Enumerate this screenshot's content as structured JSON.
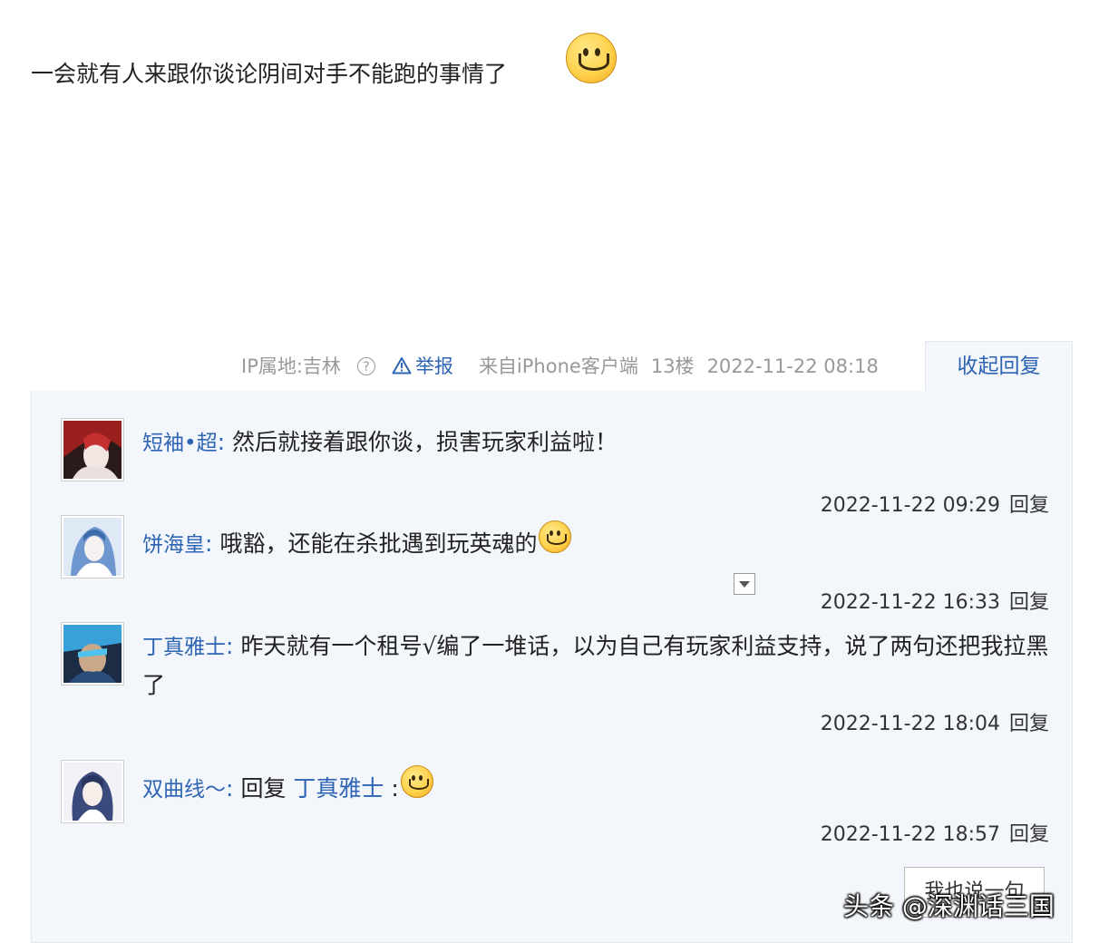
{
  "post": {
    "text": "一会就有人来跟你谈论阴间对手不能跑的事情了",
    "meta": {
      "ip": "IP属地:吉林",
      "help": "?",
      "report": "举报",
      "source": "来自iPhone客户端",
      "floor": "13楼",
      "time": "2022-11-22 08:18"
    },
    "collapse_label": "收起回复"
  },
  "replies": [
    {
      "name": "短袖•超",
      "colon": ":",
      "text": "然后就接着跟你谈，损害玩家利益啦！",
      "time": "2022-11-22 09:29",
      "reply_label": "回复"
    },
    {
      "name": "饼海皇",
      "colon": ":",
      "text": "哦豁，还能在杀批遇到玩英魂的",
      "time": "2022-11-22 16:33",
      "reply_label": "回复"
    },
    {
      "name": "丁真雅士",
      "colon": ":",
      "text": "昨天就有一个租号√编了一堆话，以为自己有玩家利益支持，说了两句还把我拉黑了",
      "time": "2022-11-22 18:04",
      "reply_label": "回复"
    },
    {
      "name": "双曲线～",
      "colon": ":",
      "prefix": "回复",
      "target": "丁真雅士",
      "suffix": ":",
      "time": "2022-11-22 18:57",
      "reply_label": "回复"
    }
  ],
  "say_button": "我也说一句",
  "watermark": "头条 @深渊话三国",
  "colors": {
    "link": "#2d64b3",
    "panel_bg": "#f3f6fb",
    "meta_gray": "#999999"
  }
}
